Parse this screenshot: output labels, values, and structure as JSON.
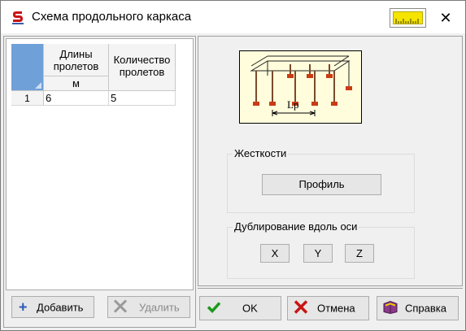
{
  "window": {
    "title": "Схема продольного каркаса",
    "close_symbol": "✕"
  },
  "table": {
    "columns": [
      {
        "header": "Длины пролетов",
        "unit": "м"
      },
      {
        "header": "Количество пролетов",
        "unit": ""
      }
    ],
    "rows": [
      {
        "num": "1",
        "span_length": "6",
        "span_count": "5"
      }
    ]
  },
  "left_buttons": {
    "add": "Добавить",
    "delete": "Удалить"
  },
  "scheme_label": "Lp",
  "stiffness": {
    "title": "Жесткости",
    "profile_button": "Профиль"
  },
  "duplication": {
    "title": "Дублирование вдоль оси",
    "x": "X",
    "y": "Y",
    "z": "Z"
  },
  "footer": {
    "ok": "OK",
    "cancel": "Отмена",
    "help": "Справка"
  },
  "colors": {
    "accent_blue": "#6fa0d8",
    "ok_green": "#1a9a1a",
    "cancel_red": "#c81414",
    "scheme_bg": "#fffddc",
    "ruler_yellow": "#f4e400"
  }
}
